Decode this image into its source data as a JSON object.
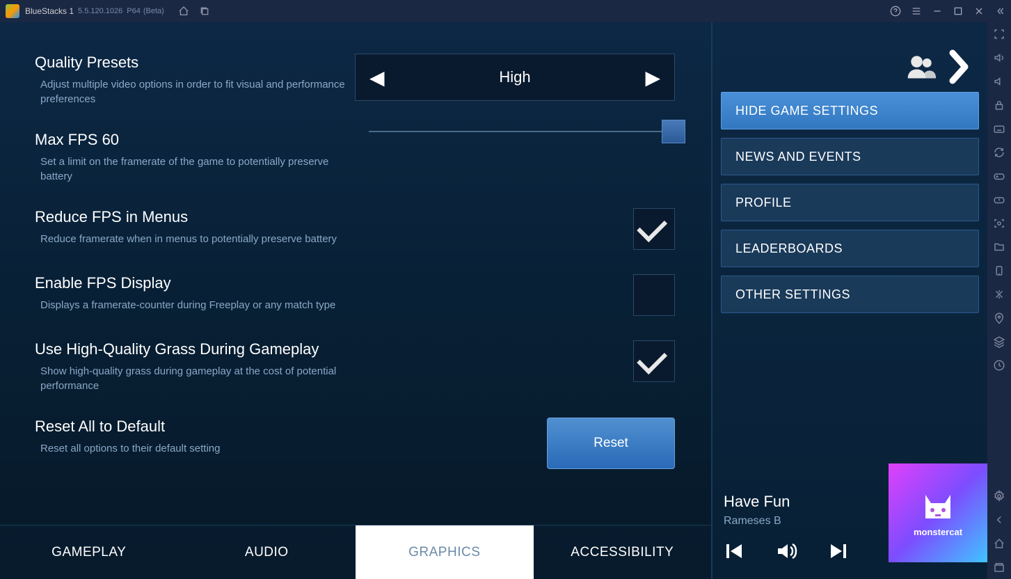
{
  "titlebar": {
    "app_name": "BlueStacks 1",
    "version": "5.5.120.1026",
    "arch": "P64",
    "beta": "(Beta)"
  },
  "settings": {
    "quality": {
      "title": "Quality Presets",
      "desc": "Adjust multiple video options in order to fit visual and performance preferences",
      "value": "High"
    },
    "maxfps": {
      "title": "Max FPS 60",
      "desc": "Set a limit on the framerate of the game to potentially preserve battery"
    },
    "reducefps": {
      "title": "Reduce FPS in Menus",
      "desc": "Reduce framerate when in menus to potentially preserve battery"
    },
    "fpsdisplay": {
      "title": "Enable FPS Display",
      "desc": "Displays a framerate-counter during Freeplay or any match type"
    },
    "grass": {
      "title": "Use High-Quality Grass During Gameplay",
      "desc": "Show high-quality grass during gameplay at the cost of potential performance"
    },
    "reset": {
      "title": "Reset All to Default",
      "desc": "Reset all options to their default setting",
      "button": "Reset"
    }
  },
  "tabs": {
    "gameplay": "GAMEPLAY",
    "audio": "AUDIO",
    "graphics": "GRAPHICS",
    "accessibility": "ACCESSIBILITY"
  },
  "menu": {
    "hide_settings": "HIDE GAME SETTINGS",
    "news": "NEWS AND EVENTS",
    "profile": "PROFILE",
    "leaderboards": "LEADERBOARDS",
    "other": "OTHER SETTINGS"
  },
  "music": {
    "title": "Have Fun",
    "artist": "Rameses B",
    "album_label": "monstercat"
  }
}
